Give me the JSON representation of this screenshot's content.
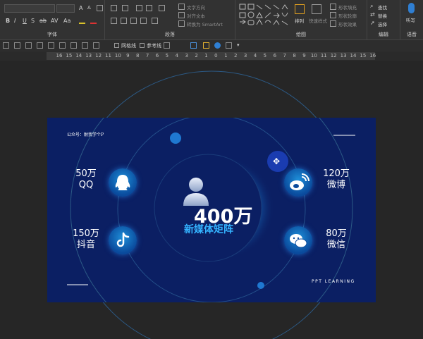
{
  "ribbon": {
    "groups": {
      "font": "字体",
      "paragraph": "段落",
      "drawing": "绘图",
      "editing": "编辑",
      "voice": "语音"
    },
    "paragraph_items": {
      "text_direction": "文字方向",
      "align_text": "对齐文本",
      "convert_smartart": "转换为 SmartArt"
    },
    "drawing_items": {
      "arrange": "排列",
      "quick_styles": "快速样式",
      "shape_fill": "形状填充",
      "shape_outline": "形状轮廓",
      "shape_effects": "形状效果"
    },
    "editing_items": {
      "find": "查找",
      "replace": "替换",
      "select": "选择"
    },
    "voice_items": {
      "dictate": "听写"
    }
  },
  "quick_toolbar": {
    "gridlines": "网格线",
    "guides": "参考线"
  },
  "ruler": {
    "ticks": [
      "16",
      "15",
      "14",
      "13",
      "12",
      "11",
      "10",
      "9",
      "8",
      "7",
      "6",
      "5",
      "4",
      "3",
      "2",
      "1",
      "0",
      "1",
      "2",
      "3",
      "4",
      "5",
      "6",
      "7",
      "8",
      "9",
      "10",
      "11",
      "12",
      "13",
      "14",
      "15",
      "16"
    ]
  },
  "slide": {
    "account": "公众号：耐我学个P",
    "brand": "PPT LEARNING",
    "center_value": "400万",
    "center_label": "新媒体矩阵",
    "stats": {
      "qq": {
        "value": "50万",
        "name": "QQ"
      },
      "douyin": {
        "value": "150万",
        "name": "抖音"
      },
      "weibo": {
        "value": "120万",
        "name": "微博"
      },
      "wechat": {
        "value": "80万",
        "name": "微信"
      }
    }
  },
  "colors": {
    "slide_bg": "#0b1f63",
    "accent": "#1fa3ff",
    "ribbon_bg": "#323232",
    "canvas_bg": "#262626"
  }
}
